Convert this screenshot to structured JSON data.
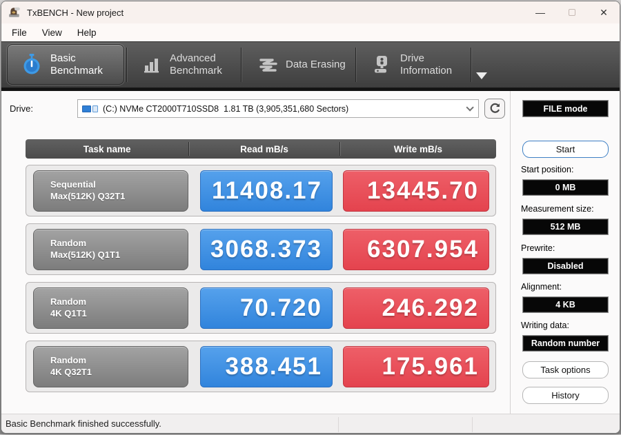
{
  "window": {
    "title": "TxBENCH - New project"
  },
  "titlebar": {
    "minimize_glyph": "—",
    "close_glyph": "✕"
  },
  "menu": {
    "file": "File",
    "view": "View",
    "help": "Help"
  },
  "tabs": {
    "basic": {
      "line1": "Basic",
      "line2": "Benchmark"
    },
    "advanced": {
      "line1": "Advanced",
      "line2": "Benchmark"
    },
    "erasing": {
      "line1": "Data Erasing"
    },
    "drive_info": {
      "line1": "Drive",
      "line2": "Information"
    }
  },
  "drive": {
    "label": "Drive:",
    "selected": "(C:) NVMe CT2000T710SSD8  1.81 TB (3,905,351,680 Sectors)",
    "file_mode_label": "FILE mode"
  },
  "table": {
    "headers": {
      "task": "Task name",
      "read": "Read mB/s",
      "write": "Write mB/s"
    },
    "rows": [
      {
        "task_line1": "Sequential",
        "task_line2": "Max(512K) Q32T1",
        "read": "11408.17",
        "write": "13445.70"
      },
      {
        "task_line1": "Random",
        "task_line2": "Max(512K) Q1T1",
        "read": "3068.373",
        "write": "6307.954"
      },
      {
        "task_line1": "Random",
        "task_line2": "4K Q1T1",
        "read": "70.720",
        "write": "246.292"
      },
      {
        "task_line1": "Random",
        "task_line2": "4K Q32T1",
        "read": "388.451",
        "write": "175.961"
      }
    ]
  },
  "sidebar": {
    "start_button": "Start",
    "fields": [
      {
        "label": "Start position:",
        "value": "0 MB"
      },
      {
        "label": "Measurement size:",
        "value": "512 MB"
      },
      {
        "label": "Prewrite:",
        "value": "Disabled"
      },
      {
        "label": "Alignment:",
        "value": "4 KB"
      },
      {
        "label": "Writing data:",
        "value": "Random number"
      }
    ],
    "task_options_button": "Task options",
    "history_button": "History"
  },
  "statusbar": {
    "message": "Basic Benchmark finished successfully."
  },
  "colors": {
    "read_box": "#3b8de4",
    "write_box": "#e8505b",
    "tab_accent": "#3e9ae6",
    "value_box_bg": "#070707"
  }
}
